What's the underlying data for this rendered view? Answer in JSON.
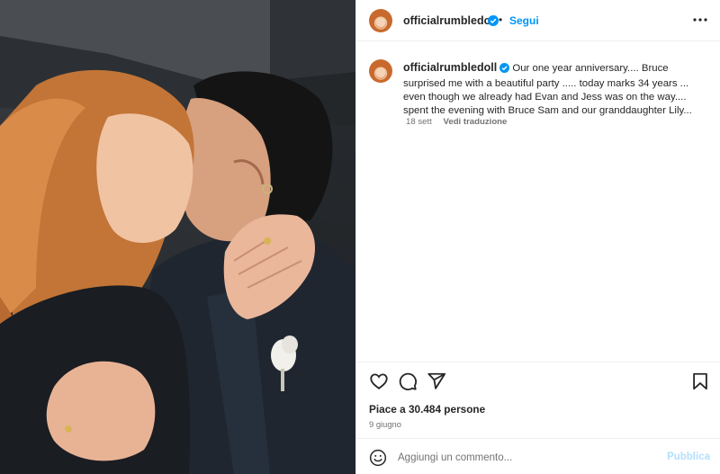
{
  "post": {
    "username": "officialrumbledoll",
    "verified": true,
    "follow_label": "Segui",
    "separator": "•",
    "more_icon": "more-horizontal-icon"
  },
  "caption": {
    "username": "officialrumbledoll",
    "text": "Our one year anniversary.... Bruce surprised me with a beautiful party ..... today marks 34 years ... even though we already had Evan and Jess was on the way.... spent the evening with Bruce Sam and our granddaughter Lily...",
    "time": "18 sett",
    "translate_label": "Vedi traduzione"
  },
  "actions": {
    "like_icon": "heart-icon",
    "comment_icon": "comment-icon",
    "share_icon": "send-icon",
    "save_icon": "bookmark-icon",
    "likes_text": "Piace a 30.484 persone",
    "date": "9 giugno"
  },
  "comment": {
    "placeholder": "Aggiungi un commento...",
    "publish_label": "Pubblica",
    "emoji_icon": "emoji-smile-icon"
  },
  "colors": {
    "link_blue": "#0095f6",
    "publish_disabled": "#b2dffc",
    "text_primary": "#262626",
    "text_secondary": "#737373"
  }
}
